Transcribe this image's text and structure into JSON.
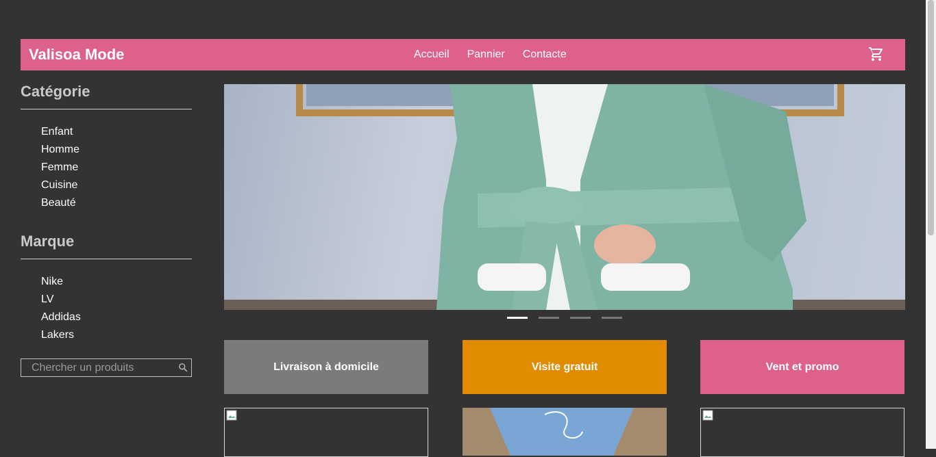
{
  "header": {
    "brand": "Valisoa Mode",
    "nav": [
      "Accueil",
      "Pannier",
      "Contacte"
    ],
    "cart_icon": "cart-icon"
  },
  "sidebar": {
    "category_title": "Catégorie",
    "categories": [
      "Enfant",
      "Homme",
      "Femme",
      "Cuisine",
      "Beauté"
    ],
    "brand_title": "Marque",
    "brands": [
      "Nike",
      "LV",
      "Addidas",
      "Lakers"
    ],
    "search_placeholder": "Chercher un produits"
  },
  "carousel": {
    "slide_count": 4,
    "active_index": 0
  },
  "features": [
    "Livraison à domicile",
    "Visite gratuit",
    "Vent et promo"
  ],
  "colors": {
    "background": "#333333",
    "accent_pink": "#de6189",
    "accent_orange": "#e08b00",
    "feature_gray": "#7b7b7b"
  }
}
